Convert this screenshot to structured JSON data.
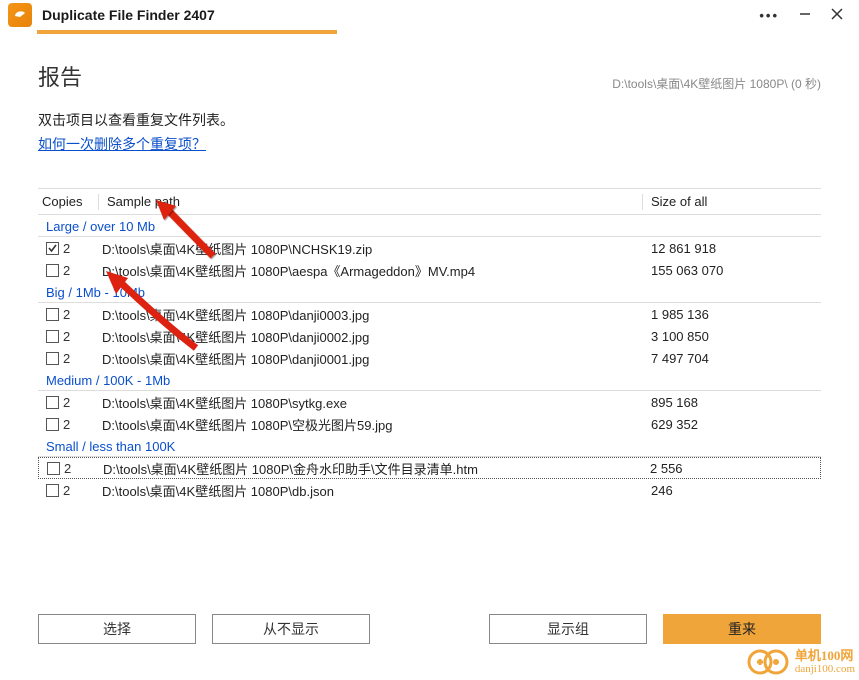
{
  "app": {
    "title": "Duplicate File Finder 2407"
  },
  "page": {
    "title": "报告",
    "scan_path": "D:\\tools\\桌面\\4K壁纸图片 1080P\\ (0 秒)",
    "instruction": "双击项目以查看重复文件列表。",
    "help_link": "如何一次删除多个重复项？"
  },
  "columns": {
    "copies": "Copies",
    "path": "Sample path",
    "size": "Size of all"
  },
  "groups": [
    {
      "label": "Large / over 10 Mb",
      "rows": [
        {
          "checked": true,
          "copies": "2",
          "path": "D:\\tools\\桌面\\4K壁纸图片 1080P\\NCHSK19.zip",
          "size": "12 861 918"
        },
        {
          "checked": false,
          "copies": "2",
          "path": "D:\\tools\\桌面\\4K壁纸图片 1080P\\aespa《Armageddon》MV.mp4",
          "size": "155 063 070"
        }
      ]
    },
    {
      "label": "Big / 1Mb - 10Mb",
      "rows": [
        {
          "checked": false,
          "copies": "2",
          "path": "D:\\tools\\桌面\\4K壁纸图片 1080P\\danji0003.jpg",
          "size": "1 985 136"
        },
        {
          "checked": false,
          "copies": "2",
          "path": "D:\\tools\\桌面\\4K壁纸图片 1080P\\danji0002.jpg",
          "size": "3 100 850"
        },
        {
          "checked": false,
          "copies": "2",
          "path": "D:\\tools\\桌面\\4K壁纸图片 1080P\\danji0001.jpg",
          "size": "7 497 704"
        }
      ]
    },
    {
      "label": "Medium / 100K - 1Mb",
      "rows": [
        {
          "checked": false,
          "copies": "2",
          "path": "D:\\tools\\桌面\\4K壁纸图片 1080P\\sytkg.exe",
          "size": "895 168"
        },
        {
          "checked": false,
          "copies": "2",
          "path": "D:\\tools\\桌面\\4K壁纸图片 1080P\\空极光图片59.jpg",
          "size": "629 352"
        }
      ]
    },
    {
      "label": "Small / less than 100K",
      "rows": [
        {
          "checked": false,
          "copies": "2",
          "path": "D:\\tools\\桌面\\4K壁纸图片 1080P\\金舟水印助手\\文件目录清单.htm",
          "size": "2 556",
          "selected": true
        },
        {
          "checked": false,
          "copies": "2",
          "path": "D:\\tools\\桌面\\4K壁纸图片 1080P\\db.json",
          "size": "246"
        }
      ]
    }
  ],
  "buttons": {
    "select": "选择",
    "never_show": "从不显示",
    "show_group": "显示组",
    "retry": "重来"
  },
  "watermark": {
    "name": "单机100网",
    "url": "danji100.com"
  }
}
